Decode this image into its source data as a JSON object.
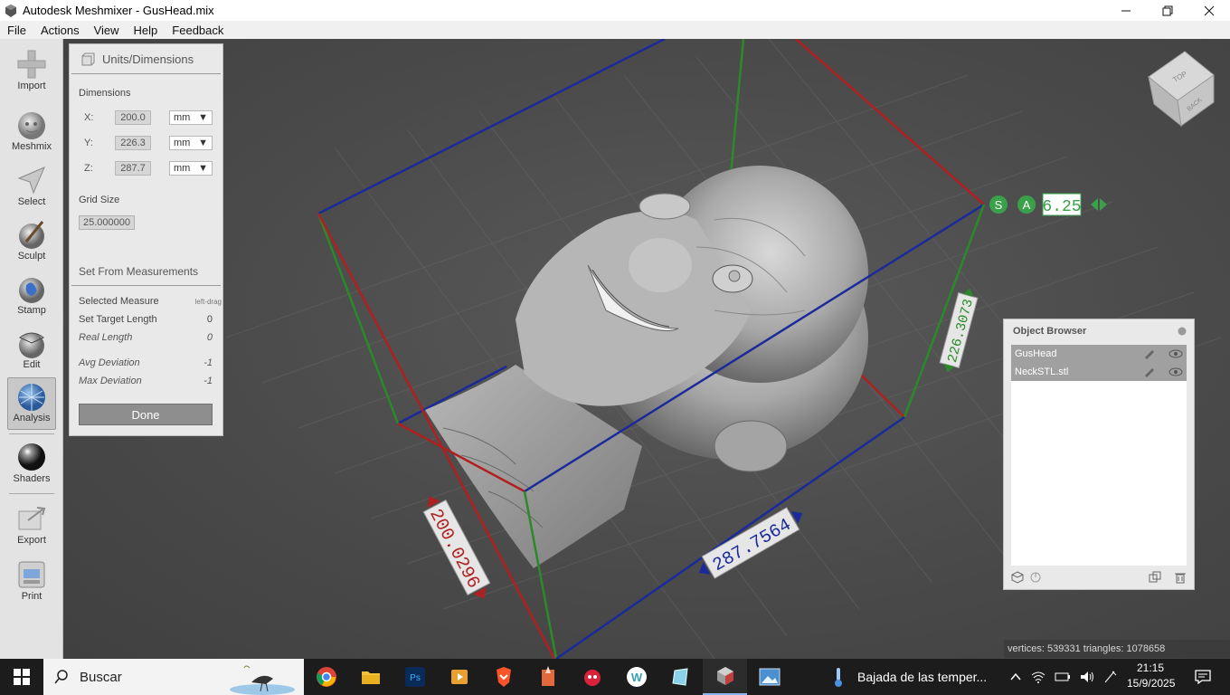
{
  "window": {
    "title": "Autodesk Meshmixer - GusHead.mix",
    "minimize_icon": "minimize-icon",
    "maximize_icon": "restore-icon",
    "close_icon": "close-icon"
  },
  "menu": [
    "File",
    "Actions",
    "View",
    "Help",
    "Feedback"
  ],
  "toolbar": {
    "items": [
      {
        "label": "Import",
        "icon": "plus-icon"
      },
      {
        "label": "Meshmix",
        "icon": "bunny-sphere-icon"
      },
      {
        "label": "Select",
        "icon": "arrow-cursor-icon"
      },
      {
        "label": "Sculpt",
        "icon": "brush-sphere-icon"
      },
      {
        "label": "Stamp",
        "icon": "stamp-sphere-icon"
      },
      {
        "label": "Edit",
        "icon": "edit-sphere-icon"
      },
      {
        "label": "Analysis",
        "icon": "analysis-sphere-icon",
        "active": true
      },
      {
        "label": "Shaders",
        "icon": "shader-sphere-icon"
      },
      {
        "label": "Export",
        "icon": "export-icon"
      },
      {
        "label": "Print",
        "icon": "printer-icon"
      }
    ]
  },
  "units_panel": {
    "title": "Units/Dimensions",
    "dimensions_label": "Dimensions",
    "dims": [
      {
        "axis": "X:",
        "value": "200.0",
        "unit": "mm"
      },
      {
        "axis": "Y:",
        "value": "226.3",
        "unit": "mm"
      },
      {
        "axis": "Z:",
        "value": "287.7",
        "unit": "mm"
      }
    ],
    "grid_size_label": "Grid Size",
    "grid_size_value": "25.000000",
    "set_from_label": "Set From Measurements",
    "measurements": [
      {
        "label": "Selected Measure",
        "value": "left-drag",
        "italic": false
      },
      {
        "label": "Set Target Length",
        "value": "0",
        "italic": false
      },
      {
        "label": "Real Length",
        "value": "0",
        "italic": true
      },
      {
        "label": "Avg Deviation",
        "value": "-1",
        "italic": true
      },
      {
        "label": "Max Deviation",
        "value": "-1",
        "italic": true
      }
    ],
    "done_label": "Done"
  },
  "viewport": {
    "dimension_labels": {
      "x": "200.0296",
      "y": "226.3073",
      "z": "287.7564"
    },
    "scale_controls": {
      "s_label": "S",
      "a_label": "A",
      "value": "6.25"
    },
    "view_cube": {
      "top": "TOP",
      "back": "BACK"
    }
  },
  "object_browser": {
    "title": "Object Browser",
    "objects": [
      "GusHead",
      "NeckSTL.stl"
    ]
  },
  "status": "vertices: 539331 triangles: 1078658",
  "taskbar": {
    "search_placeholder": "Buscar",
    "weather_text": "Bajada de las temper...",
    "time": "21:15",
    "date": "15/9/2025",
    "apps": [
      "chrome-icon",
      "folder-icon",
      "photoshop-icon",
      "media-player-icon",
      "brave-icon",
      "paint-icon",
      "app-red-icon",
      "webex-icon",
      "glass-icon",
      "meshmixer-icon",
      "image-viewer-icon"
    ]
  }
}
